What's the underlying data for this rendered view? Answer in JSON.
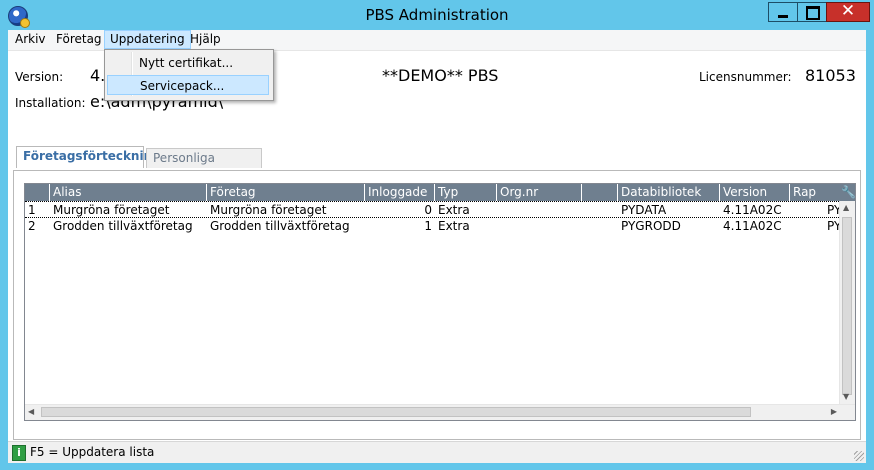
{
  "window": {
    "title": "PBS Administration",
    "minimize_glyph": "",
    "maximize_glyph": "",
    "close_glyph": "✕"
  },
  "menubar": {
    "items": [
      {
        "label": "Arkiv"
      },
      {
        "label": "Företag"
      },
      {
        "label": "Uppdatering"
      },
      {
        "label": "Hjälp"
      }
    ],
    "open_menu": {
      "items": [
        {
          "label": "Nytt certifikat..."
        },
        {
          "label": "Servicepack..."
        }
      ]
    }
  },
  "info": {
    "version_label": "Version:",
    "version_value": "4.",
    "installation_label": "Installation:",
    "installation_value": "e:\\adm\\pyramid\\",
    "demo_text": "**DEMO** PBS",
    "license_label": "Licensnummer:",
    "license_value": "81053"
  },
  "tabs": [
    {
      "label": "Företagsförteckning",
      "active": true
    },
    {
      "label": "Personliga licenser",
      "active": false
    }
  ],
  "grid": {
    "columns": [
      "",
      "Alias",
      "Företag",
      "Inloggade",
      "Typ",
      "Org.nr",
      "",
      "Databibliotek",
      "Version",
      "Rap"
    ],
    "rows": [
      [
        "1",
        "Murgröna företaget",
        "Murgröna företaget",
        "0",
        "Extra",
        "",
        "",
        "PYDATA",
        "4.11A02C",
        "PYI"
      ],
      [
        "2",
        "Grodden tillväxtföretag",
        "Grodden tillväxtföretag",
        "1",
        "Extra",
        "",
        "",
        "PYGRODD",
        "4.11A02C",
        "PYI"
      ]
    ],
    "settings_icon": "wrench-icon"
  },
  "statusbar": {
    "text": "F5 = Uppdatera lista",
    "icon_glyph": "i"
  }
}
